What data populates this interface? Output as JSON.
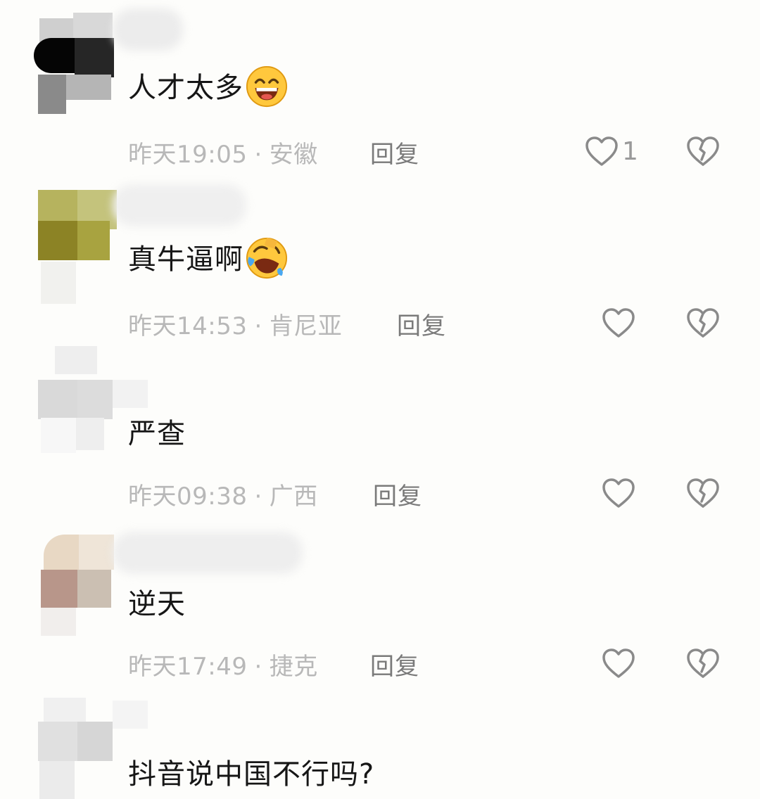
{
  "comments": [
    {
      "text": "人才太多",
      "emoji": "grinning-face-icon",
      "time": "昨天19:05",
      "location": "安徽",
      "reply_label": "回复",
      "like_count": "1"
    },
    {
      "text": "真牛逼啊",
      "emoji": "rolling-laughing-face-icon",
      "time": "昨天14:53",
      "location": "肯尼亚",
      "reply_label": "回复",
      "like_count": ""
    },
    {
      "text": "严查",
      "time": "昨天09:38",
      "location": "广西",
      "reply_label": "回复",
      "like_count": ""
    },
    {
      "text": "逆天",
      "time": "昨天17:49",
      "location": "捷克",
      "reply_label": "回复",
      "like_count": ""
    },
    {
      "text": "抖音说中国不行吗?"
    }
  ],
  "separator": "·",
  "icons": {
    "like": "heart-outline-icon",
    "dislike": "broken-heart-icon"
  },
  "colors": {
    "background": "#fdfdfb",
    "text": "#161616",
    "meta": "#b8b8b8",
    "reply": "#7a7a7a",
    "icon": "#8a8a8a"
  }
}
